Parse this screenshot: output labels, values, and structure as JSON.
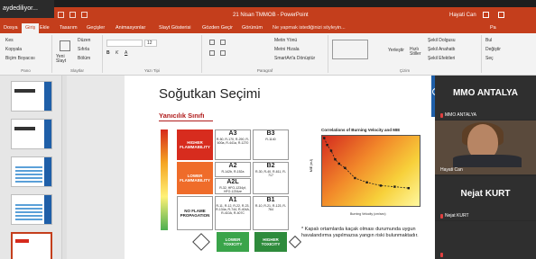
{
  "recording": {
    "label": "aydediliyor..."
  },
  "titlebar": {
    "doc_title": "21 Nisan TMMOB - PowerPoint",
    "user": "Hayati Can"
  },
  "tabs": [
    {
      "label": "Dosya"
    },
    {
      "label": "Giriş"
    },
    {
      "label": "Ekle"
    },
    {
      "label": "Tasarım"
    },
    {
      "label": "Geçişler"
    },
    {
      "label": "Animasyonlar"
    },
    {
      "label": "Slayt Gösterisi"
    },
    {
      "label": "Gözden Geçir"
    },
    {
      "label": "Görünüm"
    }
  ],
  "search_hint": "Ne yapmak istediğinizi söyleyin...",
  "share_label": "Pa",
  "ribbon": {
    "clipboard": {
      "cut": "Kes",
      "copy": "Kopyala",
      "paint": "Biçim Boyacısı",
      "label": "Pano"
    },
    "slides": {
      "new_slide": "Yeni Slayt",
      "layout": "Düzen",
      "reset": "Sıfırla",
      "section": "Bölüm",
      "label": "Slaytlar"
    },
    "font": {
      "label": "Yazı Tipi",
      "size": "12"
    },
    "paragraph": {
      "text_direction": "Metin Yönü",
      "align_text": "Metni Hizala",
      "smartart": "SmartArt'a Dönüştür",
      "label": "Paragraf"
    },
    "drawing": {
      "arrange": "Yerleştir",
      "quick_styles": "Hızlı Stiller",
      "fill": "Şekil Dolgusu",
      "outline": "Şekil Anahattı",
      "effects": "Şekil Efektleri",
      "label": "Çizim"
    },
    "editing": {
      "find": "Bul",
      "replace": "Değiştir",
      "select": "Seç"
    }
  },
  "slide": {
    "title": "Soğutkan Seçimi",
    "subtitle": "Yanıcılık Sınıfı",
    "matrix": {
      "rows": [
        {
          "label": "HIGHER FLAMMABILITY",
          "color": "#d72c1e"
        },
        {
          "label": "LOWER FLAMMABILITY",
          "color": "#ef6c2a"
        },
        {
          "label": "NO FLAME PROPAGATION",
          "color": "#ffffff"
        }
      ],
      "cells": {
        "a3": {
          "code": "A3",
          "examples": "R-50, R-170, R-290, R-600a, R-441a, R-1270"
        },
        "b3": {
          "code": "B3",
          "examples": "R-1140"
        },
        "a2": {
          "code": "A2",
          "examples": "R-142b, R-152a"
        },
        "a2l": {
          "code": "A2L",
          "examples": "R-32, HFO-1234yf, HFO-1234ze"
        },
        "b2": {
          "code": "B2",
          "examples": "R-30, R-40, R-611, R-717"
        },
        "a1": {
          "code": "A1",
          "examples": "R-11, R-12, R-22, R-23, R-134a, R-744, R-404A, R-410A, R-407C"
        },
        "b1": {
          "code": "B1",
          "examples": "R-10, R-21, R-123, R-764"
        }
      },
      "cols": [
        {
          "label": "LOWER TOXICITY",
          "color": "#3aa44a"
        },
        {
          "label": "HIGHER TOXICITY",
          "color": "#2e8b3c"
        }
      ]
    },
    "footnote": "* Kapalı ortamlarda kaçak olması durumunda uygun havalandırma yapılmazsa yangın riski bulunmaktadır."
  },
  "chart_data": {
    "type": "scatter",
    "title": "Correlations of Burning Velocity and MIE",
    "xlabel": "Burning Velocity (cm/sec)",
    "ylabel": "MIE (mJ)",
    "xlim": [
      0,
      50
    ],
    "ylim_log": [
      0.01,
      1000
    ],
    "series": [
      {
        "values": [
          {
            "x": 1.5,
            "y": 600
          },
          {
            "x": 3,
            "y": 200
          },
          {
            "x": 5,
            "y": 80
          },
          {
            "x": 7,
            "y": 20
          },
          {
            "x": 9,
            "y": 10
          },
          {
            "x": 12,
            "y": 5
          },
          {
            "x": 17,
            "y": 1
          },
          {
            "x": 23,
            "y": 0.5
          },
          {
            "x": 30,
            "y": 0.3
          },
          {
            "x": 37,
            "y": 0.25
          },
          {
            "x": 44,
            "y": 0.2
          }
        ]
      }
    ]
  },
  "participants": [
    {
      "name": "MMO ANTALYA",
      "small_label": "MMO ANTALYA",
      "has_video": false
    },
    {
      "name": "Hayati Can",
      "small_label": "Hayati Can",
      "has_video": true
    },
    {
      "name": "Nejat KURT",
      "small_label": "Nejat KURT",
      "has_video": false
    },
    {
      "name": "",
      "small_label": "",
      "has_video": false
    }
  ]
}
